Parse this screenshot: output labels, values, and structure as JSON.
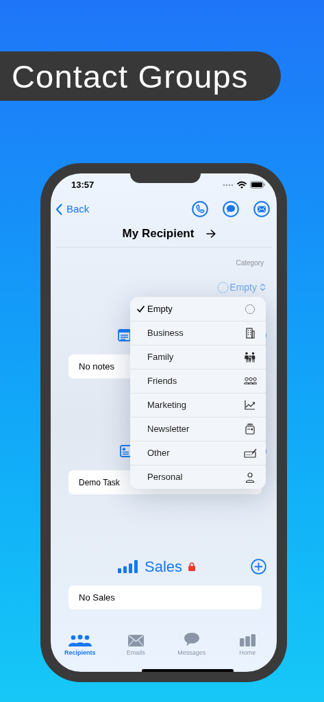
{
  "banner": {
    "title": "Contact Groups"
  },
  "status_bar": {
    "time": "13:57"
  },
  "nav": {
    "back": "Back",
    "title": "My Recipient"
  },
  "category": {
    "label": "Category",
    "value": "Empty"
  },
  "category_menu": [
    {
      "label": "Empty",
      "selected": true
    },
    {
      "label": "Business",
      "selected": false
    },
    {
      "label": "Family",
      "selected": false
    },
    {
      "label": "Friends",
      "selected": false
    },
    {
      "label": "Marketing",
      "selected": false
    },
    {
      "label": "Newsletter",
      "selected": false
    },
    {
      "label": "Other",
      "selected": false
    },
    {
      "label": "Personal",
      "selected": false
    }
  ],
  "sections": [
    {
      "kind": "notes",
      "card": "No notes"
    },
    {
      "kind": "tasks",
      "card": "Demo Task"
    },
    {
      "kind": "sales",
      "title": "Sales",
      "locked": true,
      "card": "No Sales"
    }
  ],
  "tab_bar": [
    {
      "label": "Recipients",
      "selected": true
    },
    {
      "label": "Emails",
      "selected": false
    },
    {
      "label": "Messages",
      "selected": false
    },
    {
      "label": "Home",
      "selected": false
    }
  ]
}
